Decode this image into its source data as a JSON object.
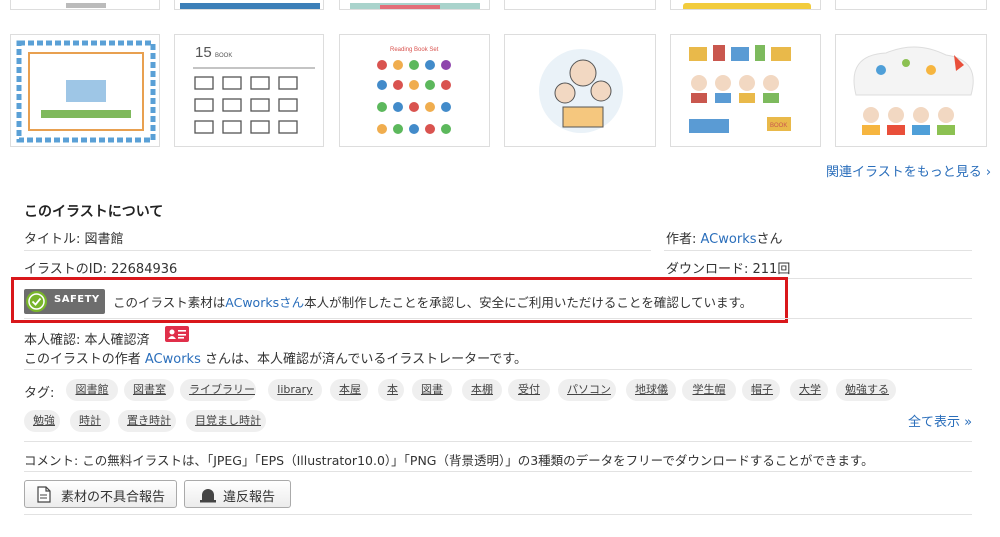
{
  "related": {
    "more_link": "関連イラストをもっと見る ›",
    "thumbnails": [
      {
        "name": "reading-book-frame-illustration",
        "colors": [
          "#4f95cc",
          "#e07b48",
          "#7cbe5a",
          "#f1c94a"
        ]
      },
      {
        "name": "book-line-icons-illustration",
        "text": "15",
        "sub": "BOOK",
        "colors": [
          "#555555"
        ]
      },
      {
        "name": "reading-book-icons-illustration",
        "text": "Reading Book Set",
        "colors": [
          "#d9534f",
          "#f0ad4e",
          "#5cb85c",
          "#428bca"
        ]
      },
      {
        "name": "mother-reading-to-children-illustration",
        "colors": [
          "#f5c77e",
          "#9bc3de",
          "#f2d8c2"
        ]
      },
      {
        "name": "children-reading-books-illustration",
        "text": "BOOK",
        "colors": [
          "#e9b94a",
          "#c9574e",
          "#5a9bd4",
          "#7dba5d"
        ]
      },
      {
        "name": "children-reading-dreams-illustration",
        "colors": [
          "#e94f3a",
          "#f6b53f",
          "#4f9fd8",
          "#8cc152"
        ]
      }
    ]
  },
  "about": {
    "heading": "このイラストについて",
    "title_label": "タイトル: ",
    "title_value": "図書館",
    "author_label": "作者: ",
    "author_name": "ACworks",
    "author_suffix": "さん",
    "id_label": "イラストのID: ",
    "id_value": "22684936",
    "downloads_label": "ダウンロード: ",
    "downloads_value": "211回"
  },
  "safety": {
    "badge": "SAFETY",
    "text_before": "このイラスト素材は",
    "text_link": "ACworksさん",
    "text_after": "本人が制作したことを承認し、安全にご利用いただけることを確認しています。",
    "highlight_color": "#d9171b"
  },
  "verification": {
    "label": "本人確認: 本人確認済",
    "desc_before": "このイラストの作者 ",
    "desc_link": "ACworks",
    "desc_after": " さんは、本人確認が済んでいるイラストレーターです。"
  },
  "tags": {
    "label": "タグ:",
    "items": [
      "図書館",
      "図書室",
      "ライブラリー",
      "library",
      "本屋",
      "本",
      "図書",
      "本棚",
      "受付",
      "パソコン",
      "地球儀",
      "学生帽",
      "帽子",
      "大学",
      "勉強する",
      "勉強",
      "時計",
      "置き時計",
      "目覚まし時計"
    ],
    "show_all": "全て表示 »"
  },
  "comment": {
    "label": "コメント: ",
    "text": "この無料イラストは、「JPEG」「EPS（Illustrator10.0）」「PNG（背景透明）」の3種類のデータをフリーでダウンロードすることができます。"
  },
  "buttons": {
    "defect_report": "素材の不具合報告",
    "violation_report": "違反報告"
  }
}
